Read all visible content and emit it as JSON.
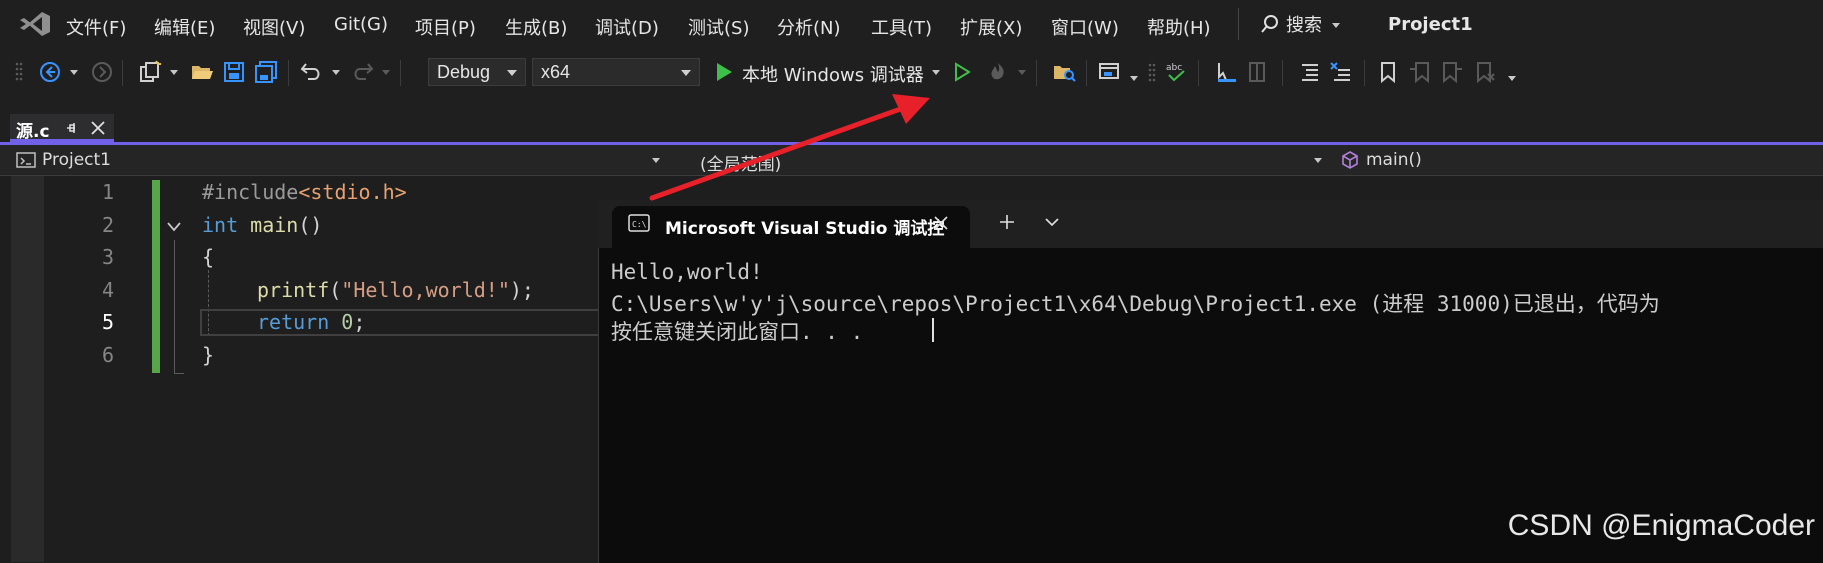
{
  "menubar": {
    "items": [
      "文件(F)",
      "编辑(E)",
      "视图(V)",
      "Git(G)",
      "项目(P)",
      "生成(B)",
      "调试(D)",
      "测试(S)",
      "分析(N)",
      "工具(T)",
      "扩展(X)",
      "窗口(W)",
      "帮助(H)"
    ],
    "search_label": "搜索",
    "project_title": "Project1"
  },
  "toolbar": {
    "config": "Debug",
    "platform": "x64",
    "run_label": "本地 Windows 调试器"
  },
  "tab": {
    "filename": "源.c"
  },
  "navbar": {
    "project": "Project1",
    "scope": "(全局范围)",
    "member": "main()"
  },
  "editor": {
    "line_numbers": [
      "1",
      "2",
      "3",
      "4",
      "5",
      "6"
    ],
    "lines": [
      {
        "parts": [
          "#include",
          "<stdio.h>"
        ]
      },
      {
        "parts": [
          "int",
          " main",
          "()"
        ]
      },
      {
        "parts": [
          "{"
        ]
      },
      {
        "parts": [
          "printf",
          "(",
          "\"Hello,world!\"",
          ");"
        ]
      },
      {
        "parts": [
          "return",
          " ",
          "0",
          ";"
        ]
      },
      {
        "parts": [
          "}"
        ]
      }
    ]
  },
  "terminal": {
    "title": "Microsoft Visual Studio 调试控",
    "lines": [
      "Hello,world!",
      "C:\\Users\\w'y'j\\source\\repos\\Project1\\x64\\Debug\\Project1.exe (进程 31000)已退出，代码为",
      "按任意键关闭此窗口. . ."
    ]
  },
  "watermark": "CSDN @EnigmaCoder",
  "colors": {
    "accent": "#7160e8",
    "keyword": "#569cd6",
    "function": "#dcdcaa",
    "string": "#d69d85",
    "number": "#b5cea8",
    "arrow": "#e8202a",
    "run_green": "#3fbf4a"
  }
}
